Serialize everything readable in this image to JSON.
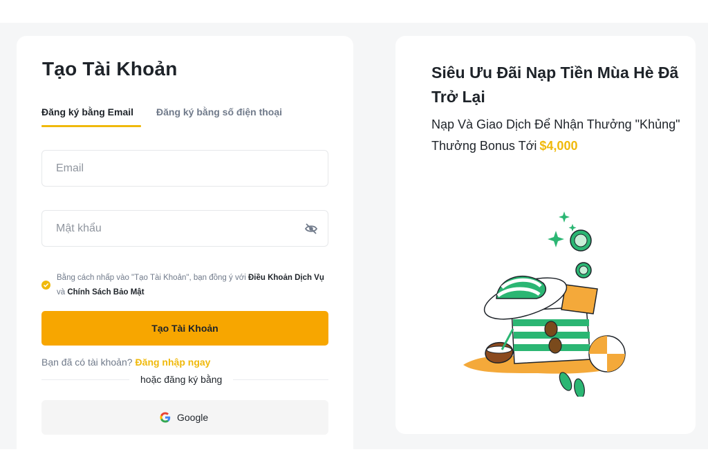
{
  "signup": {
    "title": "Tạo Tài Khoản",
    "tabs": [
      {
        "label": "Đăng ký bằng Email",
        "active": true
      },
      {
        "label": "Đăng ký bằng số điện thoại",
        "active": false
      }
    ],
    "email_placeholder": "Email",
    "password_placeholder": "Mật khẩu",
    "terms": {
      "prefix": "Bằng cách nhấp vào \"Tạo Tài Khoản\", bạn đồng ý với ",
      "terms_link": "Điều Khoản Dịch Vụ",
      "connector": " và ",
      "privacy_link": "Chính Sách Bảo Mật",
      "checked": true
    },
    "submit_label": "Tạo Tài Khoản",
    "have_account_text": "Bạn đã có tài khoản?",
    "login_link": "Đăng nhập ngay",
    "divider_label": "hoặc đăng ký bằng",
    "google_label": "Google"
  },
  "promo": {
    "title": "Siêu Ưu Đãi Nạp Tiền Mùa Hè Đã Trở Lại",
    "subtitle": "Nạp Và Giao Dịch Để Nhận Thưởng \"Khủng\" Thưởng Bonus Tới",
    "amount": "$4,000",
    "illustration_icon": "summer-beach-bag-illustration"
  },
  "colors": {
    "accent": "#f0b90b",
    "button": "#f7a600",
    "illustration_green": "#2bb673",
    "text": "#1e2329",
    "muted": "#707a8a"
  }
}
